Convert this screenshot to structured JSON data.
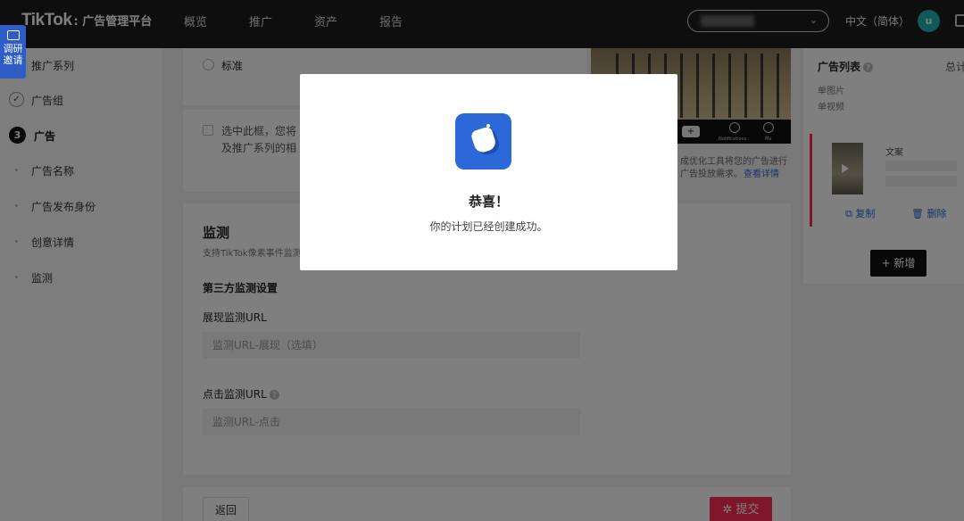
{
  "topbar": {
    "brand": "TikTok",
    "brand_suffix": ": 广告管理平台",
    "nav": [
      "概览",
      "推广",
      "资产",
      "报告"
    ],
    "language": "中文（简体）",
    "avatar_letter": "u"
  },
  "survey": {
    "line1": "调研",
    "line2": "邀请"
  },
  "sidebar": {
    "items": [
      "推广系列",
      "广告组",
      "广告",
      "广告名称",
      "广告发布身份",
      "创意详情",
      "监测"
    ],
    "step_number": "3"
  },
  "main": {
    "standard_label": "标准",
    "checkbox_line1": "选中此框，您将",
    "checkbox_line2": "及推广系列的相",
    "hint_line1": "成优化工具将您的广告进行",
    "hint_line2": "广告投放需求。",
    "hint_link": "查看详情",
    "monitor_title": "监测",
    "monitor_desc": "支持TikTok像素事件监测",
    "third_party_title": "第三方监测设置",
    "impression_label": "展现监测URL",
    "impression_placeholder": "监测URL-展现（选填）",
    "click_label": "点击监测URL",
    "click_placeholder": "监测URL-点击",
    "phone_labels": [
      "Notifications",
      "Me"
    ]
  },
  "right_panel": {
    "title": "广告列表",
    "total_prefix": "总计",
    "type1": "单图片",
    "type2": "单视频",
    "copy_label": "文案",
    "duplicate": "复制",
    "delete": "删除",
    "add_button": "+ 新增"
  },
  "footer": {
    "back": "返回",
    "submit": "提交"
  },
  "modal": {
    "title": "恭喜！",
    "message": "你的计划已经创建成功。"
  }
}
